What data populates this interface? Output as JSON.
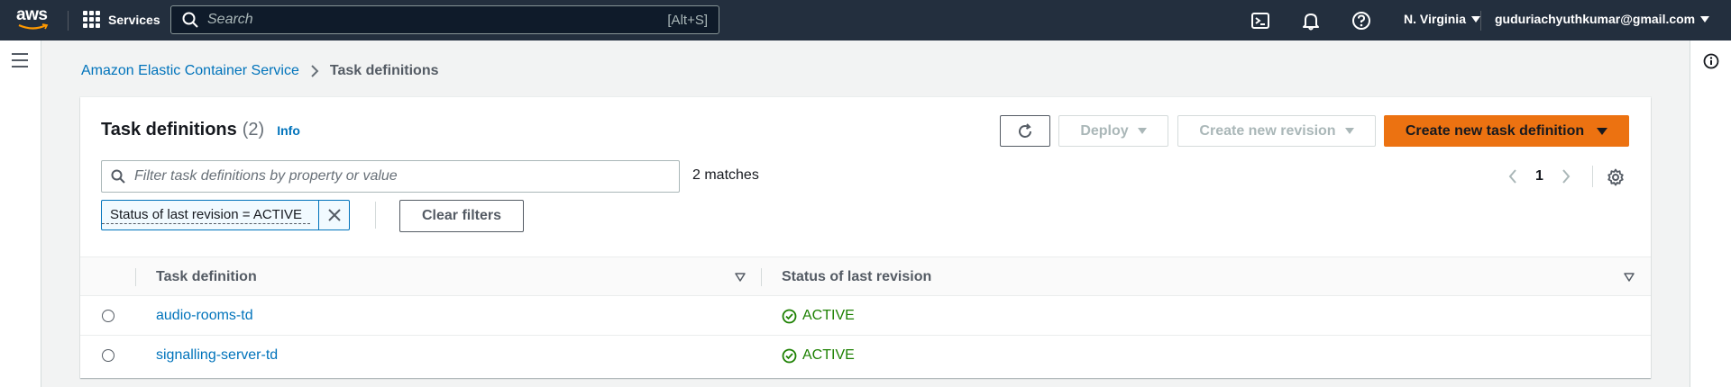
{
  "topnav": {
    "logo_text": "aws",
    "services_label": "Services",
    "search_placeholder": "Search",
    "search_shortcut": "[Alt+S]",
    "region": "N. Virginia",
    "account": "guduriachyuthkumar@gmail.com"
  },
  "breadcrumb": {
    "parent": "Amazon Elastic Container Service",
    "current": "Task definitions"
  },
  "panel": {
    "title": "Task definitions",
    "count": "(2)",
    "info_link": "Info",
    "deploy_label": "Deploy",
    "create_revision_label": "Create new revision",
    "create_task_def_label": "Create new task definition",
    "filter_placeholder": "Filter task definitions by property or value",
    "matches": "2 matches",
    "page_number": "1",
    "filter_token": "Status of last revision = ACTIVE",
    "clear_filters_label": "Clear filters"
  },
  "table": {
    "columns": [
      "Task definition",
      "Status of last revision"
    ],
    "rows": [
      {
        "name": "audio-rooms-td",
        "status": "ACTIVE"
      },
      {
        "name": "signalling-server-td",
        "status": "ACTIVE"
      }
    ]
  },
  "colors": {
    "nav_bg": "#232f3e",
    "link": "#0073bb",
    "primary": "#ec7211",
    "success": "#1d8102"
  }
}
